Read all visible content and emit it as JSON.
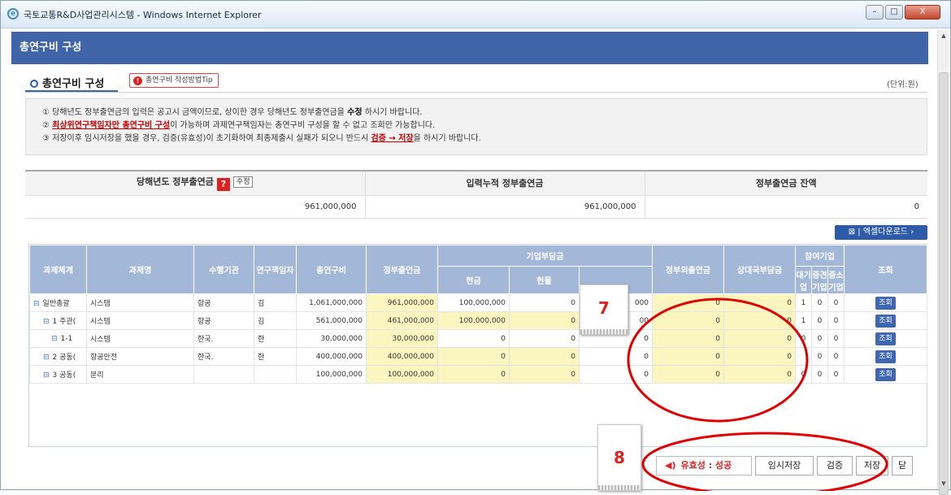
{
  "window": {
    "title": "국토교통R&D사업관리시스템 - Windows Internet Explorer",
    "controls": [
      "–",
      "□",
      "X"
    ]
  },
  "header": {
    "title": "총연구비 구성"
  },
  "section": {
    "title": "총연구비 구성",
    "tip_button": "총연구비 작성방법Tip",
    "unit": "(단위:원)"
  },
  "notice": {
    "line1_prefix": "① 당해년도 정부출연금의 입력은 공고시 금액이므로, 상이한 경우 당해년도 정부출연금을 ",
    "line1_bold": "수정",
    "line1_suffix": " 하시기 바랍니다.",
    "line2_prefix": "② ",
    "line2_red": "최상위연구책임자만 총연구비 구성",
    "line2_suffix": "이 가능하며 과제연구책임자는 총연구비 구성을 할 수 없고 조회만 가능합니다.",
    "line3_prefix": "③ 저장이후 임시저장을 했을 경우, 검증(유효성)이 초기화하여 최종제출시 실패가 되오니 반드시 ",
    "line3_red": "검증 → 저장",
    "line3_suffix": "을 하시기 바랍니다."
  },
  "summary": {
    "col1": "당해년도 정부출연금",
    "edit_button": "수정",
    "col2": "입력누적 정부출연금",
    "col3": "정부출연금 잔액",
    "values": [
      "961,000,000",
      "961,000,000",
      "0"
    ]
  },
  "excel_button": "엑셀다운로드",
  "grid": {
    "headers": {
      "system": "과제체계",
      "name": "과제명",
      "org": "수행기관",
      "researcher": "연구책임자",
      "total": "총연구비",
      "gov": "정부출연금",
      "company": "기업부담금",
      "cash": "현금",
      "inkind": "현물",
      "other_gov": "정부외출연금",
      "partner": "상대국부담금",
      "participants": "참여기업",
      "large": "대기업",
      "mid": "중견기업",
      "small": "중소기업",
      "view": "조회"
    },
    "rows": [
      {
        "system": "일반총괄",
        "name": "시스템",
        "org": "항공",
        "researcher": "김",
        "total": "1,061,000,000",
        "gov": "961,000,000",
        "cash": "100,000,000",
        "inkind": "0",
        "subtotal": "000",
        "other_gov": "0",
        "partner": "0",
        "large": "1",
        "mid": "0",
        "small": "0",
        "view": "조회"
      },
      {
        "system": "1 주관(",
        "name": "시스템",
        "org": "항공",
        "researcher": "김",
        "total": "561,000,000",
        "gov": "461,000,000",
        "cash": "100,000,000",
        "inkind": "0",
        "subtotal": "00",
        "other_gov": "0",
        "partner": "0",
        "large": "1",
        "mid": "0",
        "small": "0",
        "view": "조회"
      },
      {
        "system": "1-1",
        "name": "시스템",
        "org": "한국.",
        "researcher": "한",
        "total": "30,000,000",
        "gov": "30,000,000",
        "cash": "0",
        "inkind": "0",
        "subtotal": "0",
        "other_gov": "0",
        "partner": "0",
        "large": "0",
        "mid": "0",
        "small": "0",
        "view": "조회"
      },
      {
        "system": "2 공동(",
        "name": "항공안전",
        "org": "한국.",
        "researcher": "한",
        "total": "400,000,000",
        "gov": "400,000,000",
        "cash": "0",
        "inkind": "0",
        "subtotal": "0",
        "other_gov": "0",
        "partner": "0",
        "large": "",
        "mid": "0",
        "small": "0",
        "view": "조회"
      },
      {
        "system": "3 공동(",
        "name": "분리",
        "org": "",
        "researcher": "",
        "total": "100,000,000",
        "gov": "100,000,000",
        "cash": "0",
        "inkind": "0",
        "subtotal": "0",
        "other_gov": "0",
        "partner": "0",
        "large": "0",
        "mid": "0",
        "small": "0",
        "view": "조회"
      }
    ]
  },
  "bottom": {
    "validity": "유효성 : 성공",
    "temp_save": "임시저장",
    "verify": "검증",
    "save": "저장",
    "close": "닫"
  },
  "annotations": {
    "label7": "7",
    "label8": "8",
    "ellipse_color": "#e00000"
  },
  "colors": {
    "header_bg": "#3f64a8",
    "grid_header": "#a3b7d8",
    "yellow_cell": "#fbf6bf",
    "accent_red": "#d22222"
  }
}
